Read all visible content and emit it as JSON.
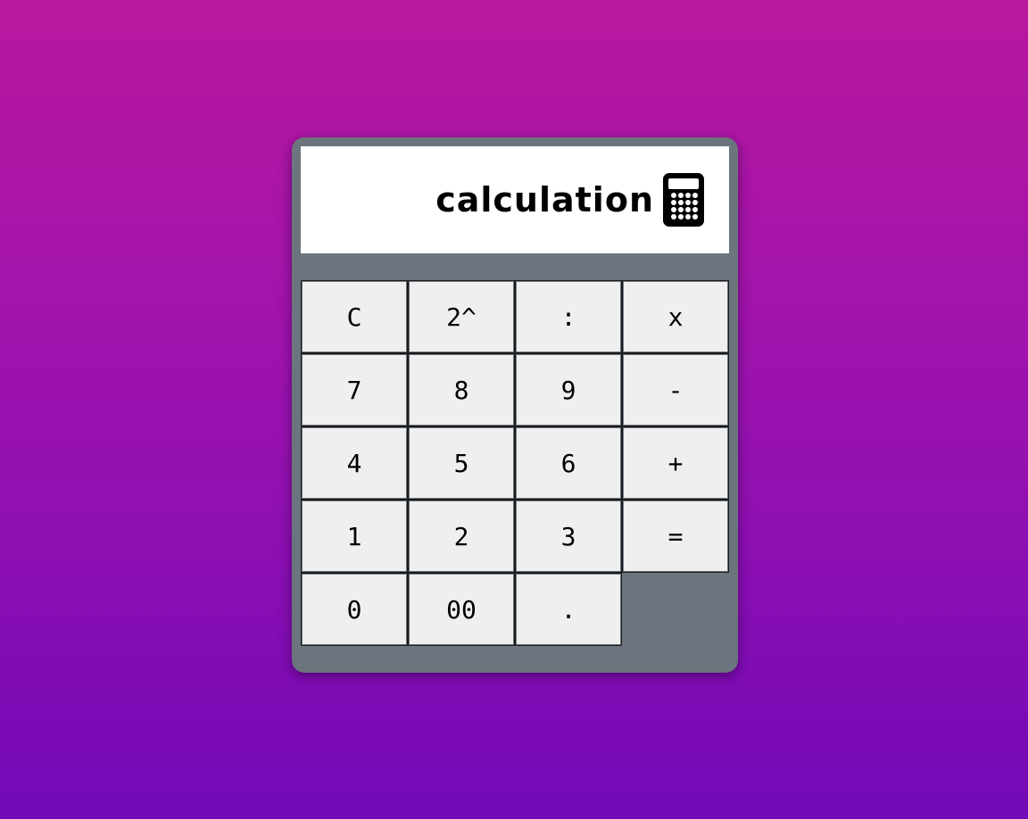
{
  "display": {
    "text": "calculation",
    "icon": "calculator-icon"
  },
  "keys": {
    "clear": "C",
    "square": "2^",
    "divide": ":",
    "multiply": "x",
    "seven": "7",
    "eight": "8",
    "nine": "9",
    "subtract": "-",
    "four": "4",
    "five": "5",
    "six": "6",
    "add": "+",
    "one": "1",
    "two": "2",
    "three": "3",
    "equals": "=",
    "zero": "0",
    "double_zero": "00",
    "decimal": "."
  },
  "colors": {
    "background_top": "#b8189e",
    "background_bottom": "#7209b7",
    "calculator_body": "#6c757d",
    "display_background": "#ffffff",
    "key_background": "#efefef",
    "text": "#000000"
  }
}
